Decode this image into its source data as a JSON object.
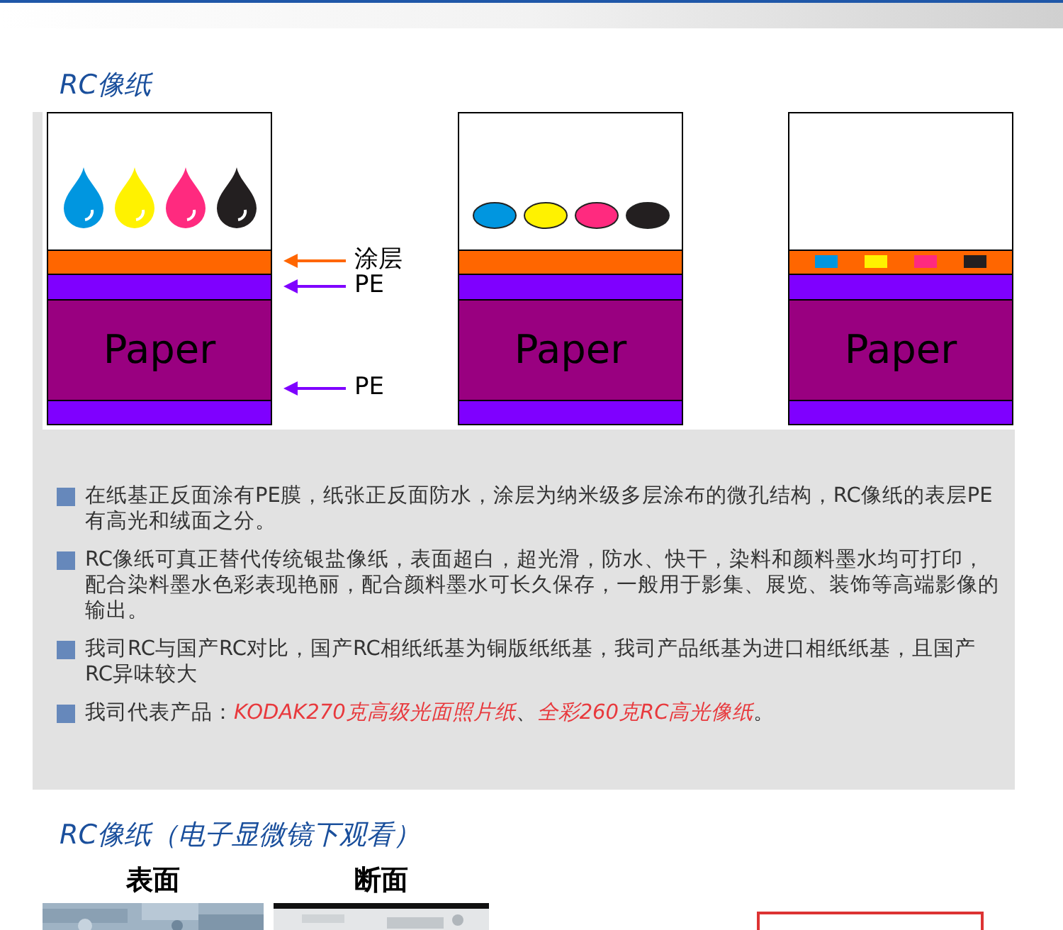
{
  "section_title": "RC像纸",
  "diagrams": [
    {
      "kind": "drops",
      "paper_label": "Paper",
      "callouts": [
        {
          "text": "涂层",
          "color": "#ff6600"
        },
        {
          "text": "PE",
          "color": "#7f00ff"
        },
        {
          "text": "PE",
          "color": "#7f00ff"
        }
      ]
    },
    {
      "kind": "dots",
      "paper_label": "Paper"
    },
    {
      "kind": "squares",
      "paper_label": "Paper"
    }
  ],
  "notes": [
    {
      "segments": [
        {
          "kind": "plain",
          "text": "在纸基正反面涂有PE膜，纸张正反面防水，涂层为纳米级多层涂布的微孔结构，RC像纸的表层PE有高光和绒面之分。"
        }
      ]
    },
    {
      "segments": [
        {
          "kind": "plain",
          "text": "RC像纸可真正替代传统银盐像纸，表面超白，超光滑，防水、快干，染料和颜料墨水均可打印，配合染料墨水色彩表现艳丽，配合颜料墨水可长久保存，一般用于影集、展览、装饰等高端影像的输出。"
        }
      ]
    },
    {
      "segments": [
        {
          "kind": "plain",
          "text": "我司RC与国产RC对比，国产RC相纸纸基为铜版纸纸基，我司产品纸基为进口相纸纸基，且国产RC异味较大"
        }
      ]
    },
    {
      "segments": [
        {
          "kind": "plain",
          "text": "我司代表产品："
        },
        {
          "kind": "link",
          "text": "KODAK270克高级光面照片纸"
        },
        {
          "kind": "plain",
          "text": "、"
        },
        {
          "kind": "link",
          "text": "全彩260克RC高光像纸"
        },
        {
          "kind": "plain",
          "text": "。"
        }
      ]
    }
  ],
  "microscope": {
    "title": "RC像纸（电子显微镜下观看）",
    "views": [
      {
        "label": "表面",
        "kind": "surface"
      },
      {
        "label": "断面",
        "kind": "section"
      }
    ]
  }
}
